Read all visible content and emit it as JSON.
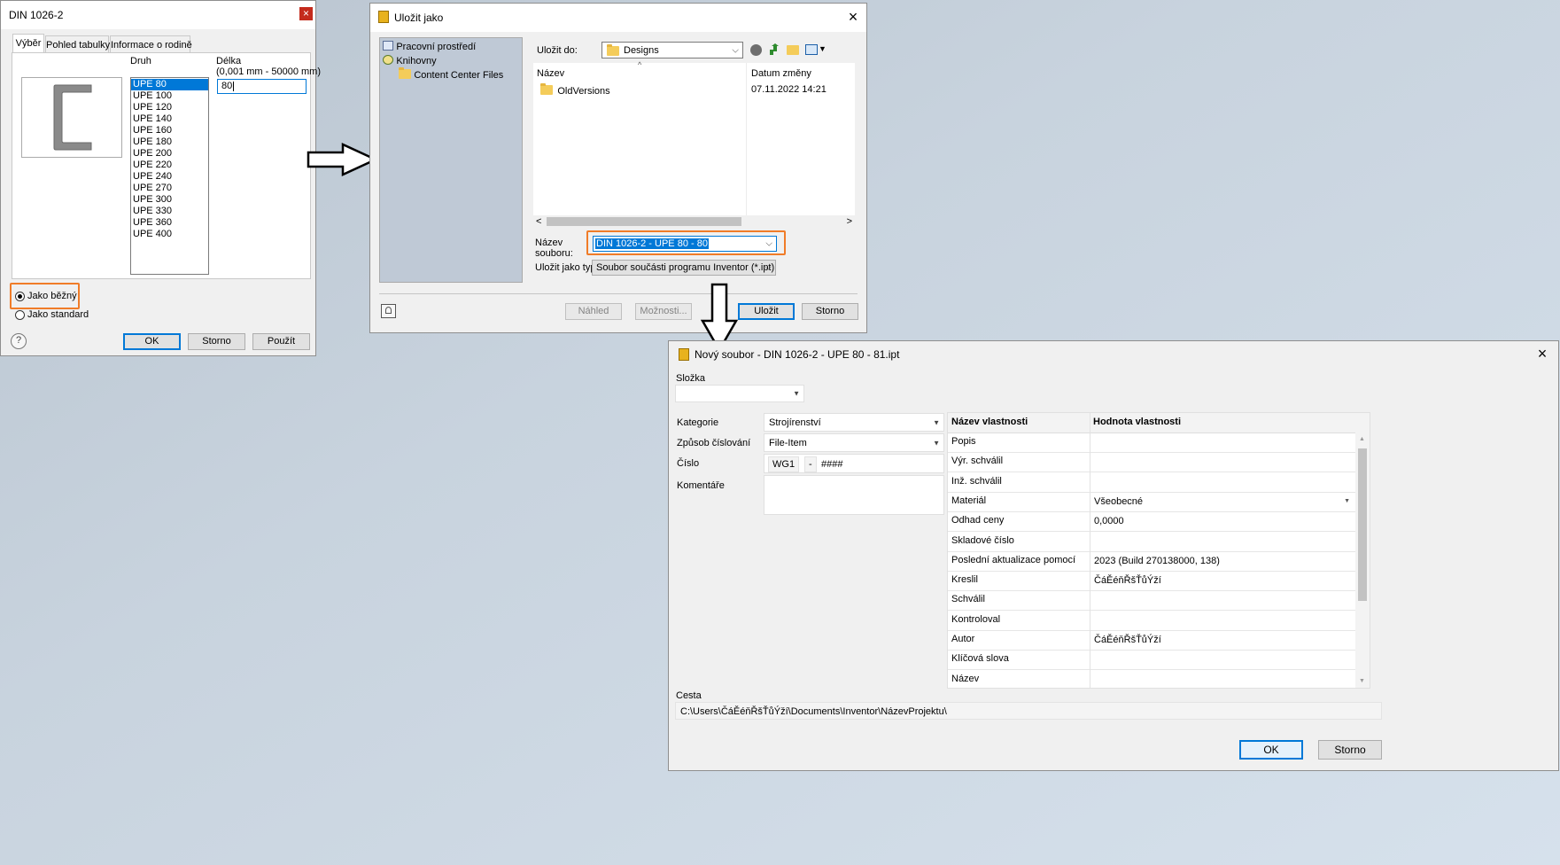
{
  "dialog1": {
    "title": "DIN 1026-2",
    "tabs": [
      "Výběr",
      "Pohled tabulky",
      "Informace o rodině"
    ],
    "druh_label": "Druh",
    "delka_label": "Délka",
    "delka_range": "(0,001 mm - 50000 mm)",
    "delka_value": "80",
    "druh_items": [
      "UPE 80",
      "UPE 100",
      "UPE 120",
      "UPE 140",
      "UPE 160",
      "UPE 180",
      "UPE 200",
      "UPE 220",
      "UPE 240",
      "UPE 270",
      "UPE 300",
      "UPE 330",
      "UPE 360",
      "UPE 400"
    ],
    "radio_bezny": "Jako běžný",
    "radio_standard": "Jako standard",
    "ok": "OK",
    "storno": "Storno",
    "pouzit": "Použít",
    "help_glyph": "?",
    "close_glyph": "×"
  },
  "dialog2": {
    "title": "Uložit jako",
    "sidebar": [
      "Pracovní prostředí",
      "Knihovny",
      "Content Center Files"
    ],
    "ulozit_do_label": "Uložit do:",
    "ulozit_do_value": "Designs",
    "col_name": "Název",
    "col_date": "Datum změny",
    "files": [
      {
        "name": "OldVersions",
        "date": "07.11.2022 14:21"
      }
    ],
    "nazev_label_1": "Název",
    "nazev_label_2": "souboru:",
    "nazev_value": "DIN 1026-2 - UPE 80 - 80",
    "typ_label": "Uložit jako typ:",
    "typ_value": "Soubor součásti programu Inventor (*.ipt)",
    "nahled": "Náhled",
    "moznosti": "Možnosti...",
    "ulozit": "Uložit",
    "storno": "Storno",
    "close_glyph": "×",
    "scroll_left": "<",
    "scroll_right": ">",
    "sort_glyph": "^"
  },
  "dialog3": {
    "title": "Nový soubor - DIN 1026-2 - UPE 80 - 81.ipt",
    "slozka_label": "Složka",
    "kategorie_label": "Kategorie",
    "kategorie_value": "Strojírenství",
    "zpusob_label": "Způsob číslování",
    "zpusob_value": "File-Item",
    "cislo_label": "Číslo",
    "cislo_prefix": "WG1",
    "cislo_sep": "-",
    "cislo_mask": "####",
    "komentare_label": "Komentáře",
    "col_name": "Název vlastnosti",
    "col_value": "Hodnota vlastnosti",
    "properties": [
      {
        "name": "Popis",
        "value": ""
      },
      {
        "name": "Výr. schválil",
        "value": ""
      },
      {
        "name": "Inž. schválil",
        "value": ""
      },
      {
        "name": "Materiál",
        "value": "Všeobecné"
      },
      {
        "name": "Odhad ceny",
        "value": "0,0000"
      },
      {
        "name": "Skladové číslo",
        "value": ""
      },
      {
        "name": "Poslední aktualizace pomocí",
        "value": "2023 (Build 270138000, 138)"
      },
      {
        "name": "Kreslil",
        "value": "ČáĚéňŘšŤůÝží"
      },
      {
        "name": "Schválil",
        "value": ""
      },
      {
        "name": "Kontroloval",
        "value": ""
      },
      {
        "name": "Autor",
        "value": "ČáĚéňŘšŤůÝží"
      },
      {
        "name": "Klíčová slova",
        "value": ""
      },
      {
        "name": "Název",
        "value": ""
      }
    ],
    "cesta_label": "Cesta",
    "cesta_value": "C:\\Users\\ČáĚéňŘšŤůÝží\\Documents\\Inventor\\NázevProjektu\\",
    "ok": "OK",
    "storno": "Storno",
    "close_glyph": "×"
  },
  "colors": {
    "highlight": "#f07c28",
    "selection": "#0078d7",
    "desktop": "#c8d3de"
  }
}
